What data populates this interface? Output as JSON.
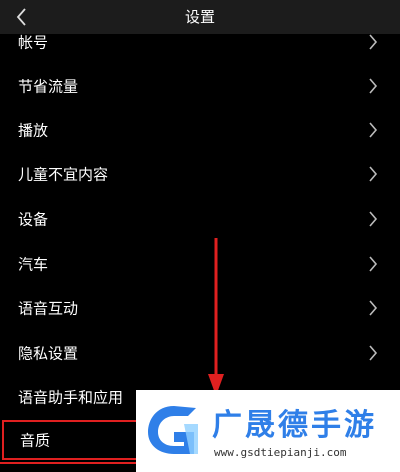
{
  "header": {
    "title": "设置"
  },
  "settings": {
    "items": [
      {
        "label": "帐号",
        "has_chevron": true
      },
      {
        "label": "节省流量",
        "has_chevron": true
      },
      {
        "label": "播放",
        "has_chevron": true
      },
      {
        "label": "儿童不宜内容",
        "has_chevron": true
      },
      {
        "label": "设备",
        "has_chevron": true
      },
      {
        "label": "汽车",
        "has_chevron": true
      },
      {
        "label": "语音互动",
        "has_chevron": true
      },
      {
        "label": "隐私设置",
        "has_chevron": true
      },
      {
        "label": "语音助手和应用",
        "has_chevron": false
      },
      {
        "label": "音质",
        "has_chevron": false
      }
    ]
  },
  "watermark": {
    "brand": "广晟德手游",
    "url": "www.gsdtiepianji.com"
  },
  "colors": {
    "background": "#000000",
    "header": "#1c1c1c",
    "highlight": "#e02020",
    "watermark_blue": "#2f7fe8"
  }
}
